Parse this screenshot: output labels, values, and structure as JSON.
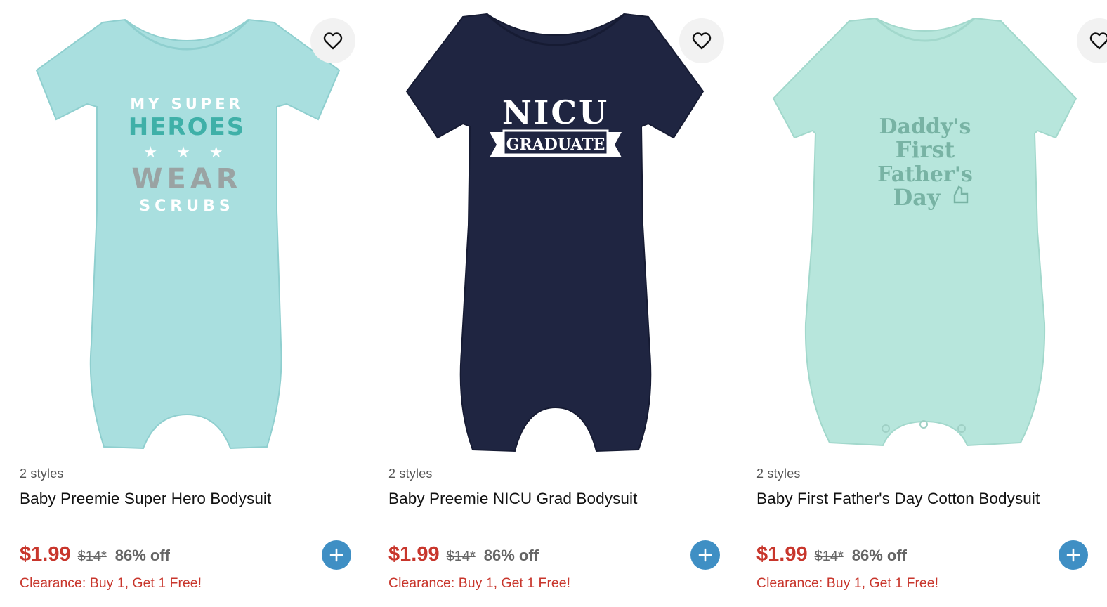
{
  "products": [
    {
      "styles": "2 styles",
      "name": "Baby Preemie Super Hero Bodysuit",
      "sale_price": "$1.99",
      "original_price": "$14*",
      "discount": "86% off",
      "promo": "Clearance: Buy 1, Get 1 Free!",
      "garment_color": "#a9dfdf",
      "print_lines": [
        "MY SUPER",
        "HEROES",
        "★ ★ ★",
        "WEAR",
        "SCRUBS"
      ]
    },
    {
      "styles": "2 styles",
      "name": "Baby Preemie NICU Grad Bodysuit",
      "sale_price": "$1.99",
      "original_price": "$14*",
      "discount": "86% off",
      "promo": "Clearance: Buy 1, Get 1 Free!",
      "garment_color": "#1f2541",
      "print_lines": [
        "NICU",
        "GRADUATE"
      ]
    },
    {
      "styles": "2 styles",
      "name": "Baby First Father's Day Cotton Bodysuit",
      "sale_price": "$1.99",
      "original_price": "$14*",
      "discount": "86% off",
      "promo": "Clearance: Buy 1, Get 1 Free!",
      "garment_color": "#b7e6dc",
      "print_lines": [
        "Daddy's",
        "First",
        "Father's",
        "Day"
      ]
    }
  ],
  "colors": {
    "sale": "#c8362c",
    "add_button": "#3f8fc4",
    "muted": "#666666"
  },
  "icons": {
    "favorite": "heart-outline-icon",
    "add": "plus-icon"
  }
}
